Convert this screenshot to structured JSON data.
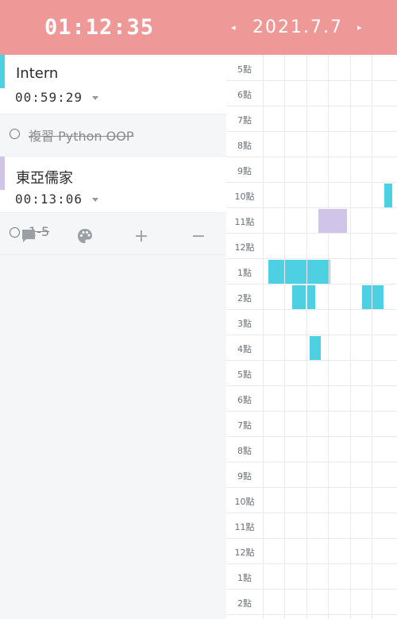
{
  "header": {
    "clock": "01:12:35",
    "date": "2021.7.7",
    "prev_icon": "◂",
    "next_icon": "▸"
  },
  "colors": {
    "header_bg": "#ee9898",
    "cyan": "#4dd0e1",
    "lavender": "#d1c4e9"
  },
  "tasks": [
    {
      "name": "Intern",
      "time": "00:59:29",
      "color": "#4dd0e1"
    },
    {
      "name": "東亞儒家",
      "time": "00:13:06",
      "color": "#d1c4e9"
    }
  ],
  "completed": [
    {
      "label": "複習 Python OOP"
    },
    {
      "label": "1-5"
    }
  ],
  "toolbar": {
    "comment_icon": "comment-icon",
    "palette_icon": "palette-icon",
    "add_label": "+",
    "remove_label": "−"
  },
  "hours": [
    "5點",
    "6點",
    "7點",
    "8點",
    "9點",
    "10點",
    "11點",
    "12點",
    "1點",
    "2點",
    "3點",
    "4點",
    "5點",
    "6點",
    "7點",
    "8點",
    "9點",
    "10點",
    "11點",
    "12點",
    "1點",
    "2點"
  ]
}
